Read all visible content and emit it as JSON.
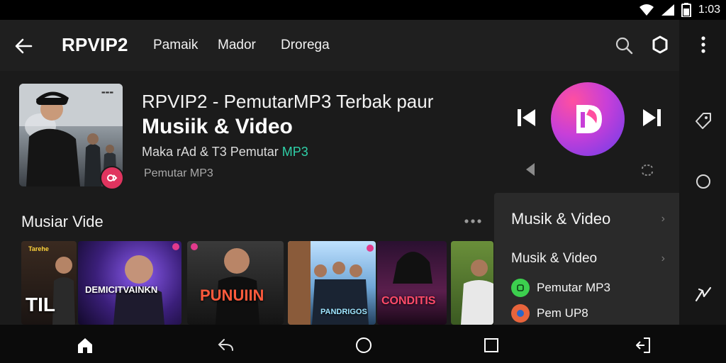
{
  "status_bar": {
    "time": "1:03",
    "icons": [
      "wifi-icon",
      "signal-icon",
      "battery-icon"
    ]
  },
  "app_bar": {
    "title": "RPVIP2",
    "tabs": [
      "Pamaik",
      "Mador",
      "Drorega"
    ],
    "icons": [
      "back-arrow-icon",
      "search-icon",
      "cast-icon",
      "overflow-menu-icon"
    ]
  },
  "hero": {
    "headline": "RPVIP2 - PemutarMP3 Terbak paur",
    "subheadline": "Musiik & Video",
    "meta_prefix": "Maka rAd &  T3  Pemutar ",
    "meta_accent": "MP3",
    "meta_small": "Pemutar MP3"
  },
  "player": {
    "logo_letter": "D",
    "controls": [
      "previous-icon",
      "play-logo",
      "next-icon",
      "small-previous-icon",
      "repeat-icon"
    ]
  },
  "section": {
    "title": "Musiar Vide"
  },
  "tiles": [
    {
      "tag": "Tarehe",
      "caption": "TIL"
    },
    {
      "tag": "",
      "caption": "DEMICITVAINKN"
    },
    {
      "tag": "",
      "caption": "PUNUIIN"
    },
    {
      "tag": "",
      "caption": "PANDRIGOS"
    },
    {
      "tag": "",
      "caption": "CONDITIS"
    },
    {
      "tag": "",
      "caption": ""
    }
  ],
  "dropdown": {
    "items": [
      {
        "label": "Musik & Video",
        "chevron": "›"
      },
      {
        "label": "Musik & Video",
        "chevron": "›"
      },
      {
        "label": "Pemutar MP3",
        "dot_color": "#3ccf4e"
      },
      {
        "label": "Pem UP8",
        "dot_color": "#e8643c"
      }
    ]
  },
  "right_rail": {
    "icons": [
      "tag-icon",
      "circle-icon",
      "sparkle-icon"
    ]
  },
  "bottom_nav": {
    "icons": [
      "home-icon",
      "back-icon",
      "home-circle-icon",
      "recents-icon",
      "exit-icon"
    ]
  },
  "colors": {
    "accent_teal": "#2fd0a8",
    "badge_pink": "#e0345f",
    "logo_pink": "#ff4fa0",
    "logo_purple": "#6a3dea"
  }
}
